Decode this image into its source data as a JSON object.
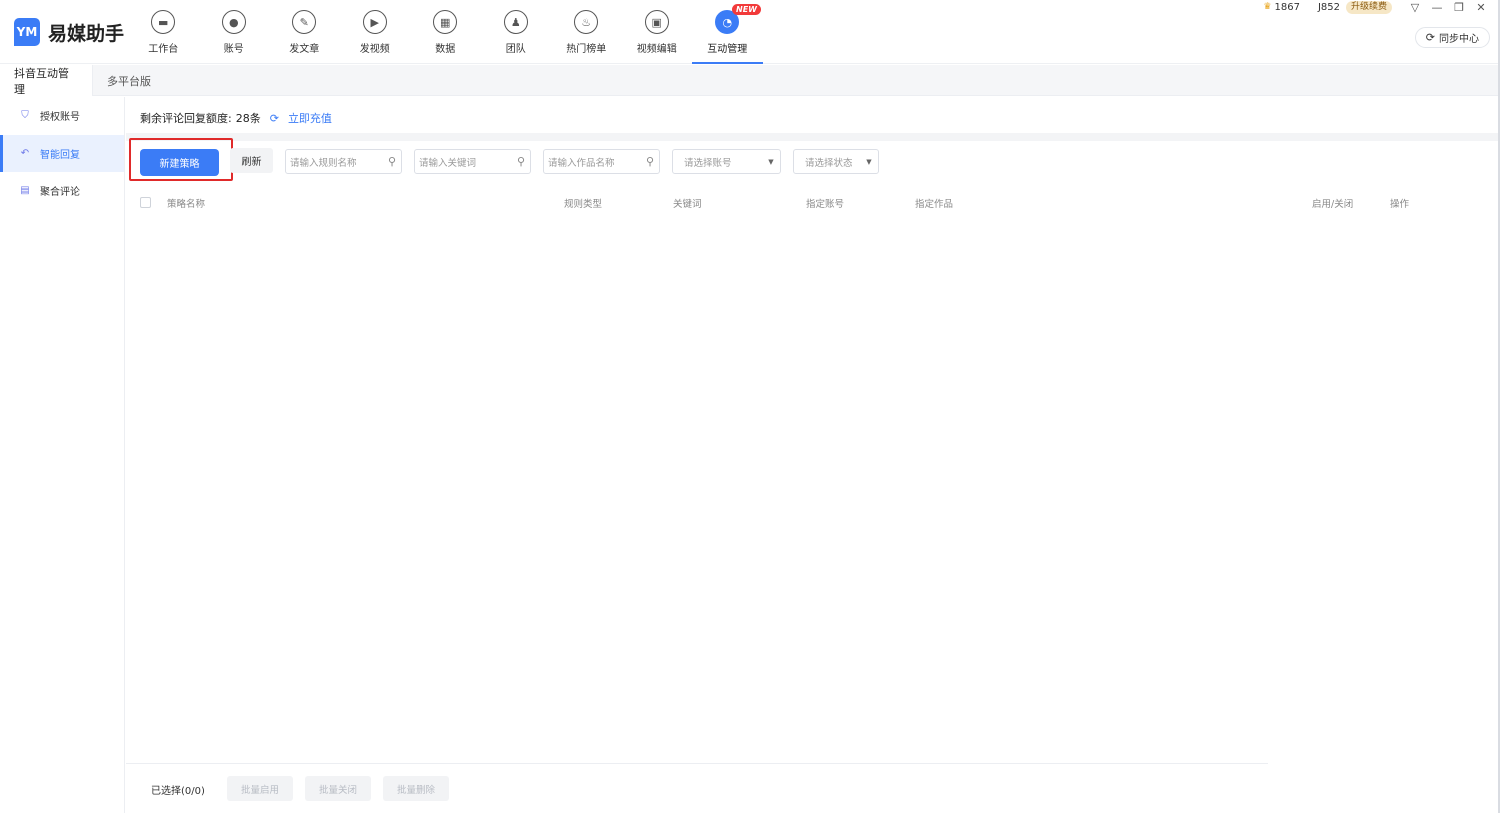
{
  "app": {
    "logo_mark": "YM",
    "name": "易媒助手"
  },
  "nav": [
    {
      "label": "工作台",
      "icon": "monitor-icon",
      "glyph": "▬"
    },
    {
      "label": "账号",
      "icon": "user-icon",
      "glyph": "●"
    },
    {
      "label": "发文章",
      "icon": "feather-icon",
      "glyph": "✎"
    },
    {
      "label": "发视频",
      "icon": "play-icon",
      "glyph": "▶"
    },
    {
      "label": "数据",
      "icon": "chart-icon",
      "glyph": "▦"
    },
    {
      "label": "团队",
      "icon": "team-icon",
      "glyph": "♟"
    },
    {
      "label": "热门榜单",
      "icon": "flame-icon",
      "glyph": "♨"
    },
    {
      "label": "视频编辑",
      "icon": "briefcase-icon",
      "glyph": "▣"
    },
    {
      "label": "互动管理",
      "icon": "chat-icon",
      "glyph": "◔",
      "active": true,
      "badge": "NEW"
    }
  ],
  "top_right": {
    "account1": "1867",
    "account2": "J852",
    "upgrade_label": "升级续费",
    "sync_label": "同步中心"
  },
  "tabs": [
    {
      "label": "抖音互动管理",
      "active": true
    },
    {
      "label": "多平台版",
      "active": false
    }
  ],
  "sidebar": [
    {
      "label": "授权账号",
      "icon": "shield-icon",
      "glyph": "⛉"
    },
    {
      "label": "智能回复",
      "icon": "reply-icon",
      "glyph": "↶",
      "active": true
    },
    {
      "label": "聚合评论",
      "icon": "comment-icon",
      "glyph": "▤"
    }
  ],
  "quota": {
    "label": "剩余评论回复额度:",
    "value": "28条",
    "recharge": "立即充值"
  },
  "toolbar": {
    "new_label": "新建策略",
    "refresh_label": "刷新",
    "rule_name_placeholder": "请输入规则名称",
    "keyword_placeholder": "请输入关键词",
    "work_name_placeholder": "请输入作品名称",
    "account_select_placeholder": "请选择账号",
    "status_select_placeholder": "请选择状态"
  },
  "table": {
    "columns": [
      "策略名称",
      "规则类型",
      "关键词",
      "指定账号",
      "指定作品",
      "启用/关闭",
      "操作"
    ],
    "rows": []
  },
  "footer": {
    "selected": "已选择(0/0)",
    "batch_enable": "批量启用",
    "batch_disable": "批量关闭",
    "batch_delete": "批量删除"
  },
  "colors": {
    "accent": "#3b7cf6",
    "highlight": "#e02a2a",
    "badge": "#f23a3a"
  }
}
